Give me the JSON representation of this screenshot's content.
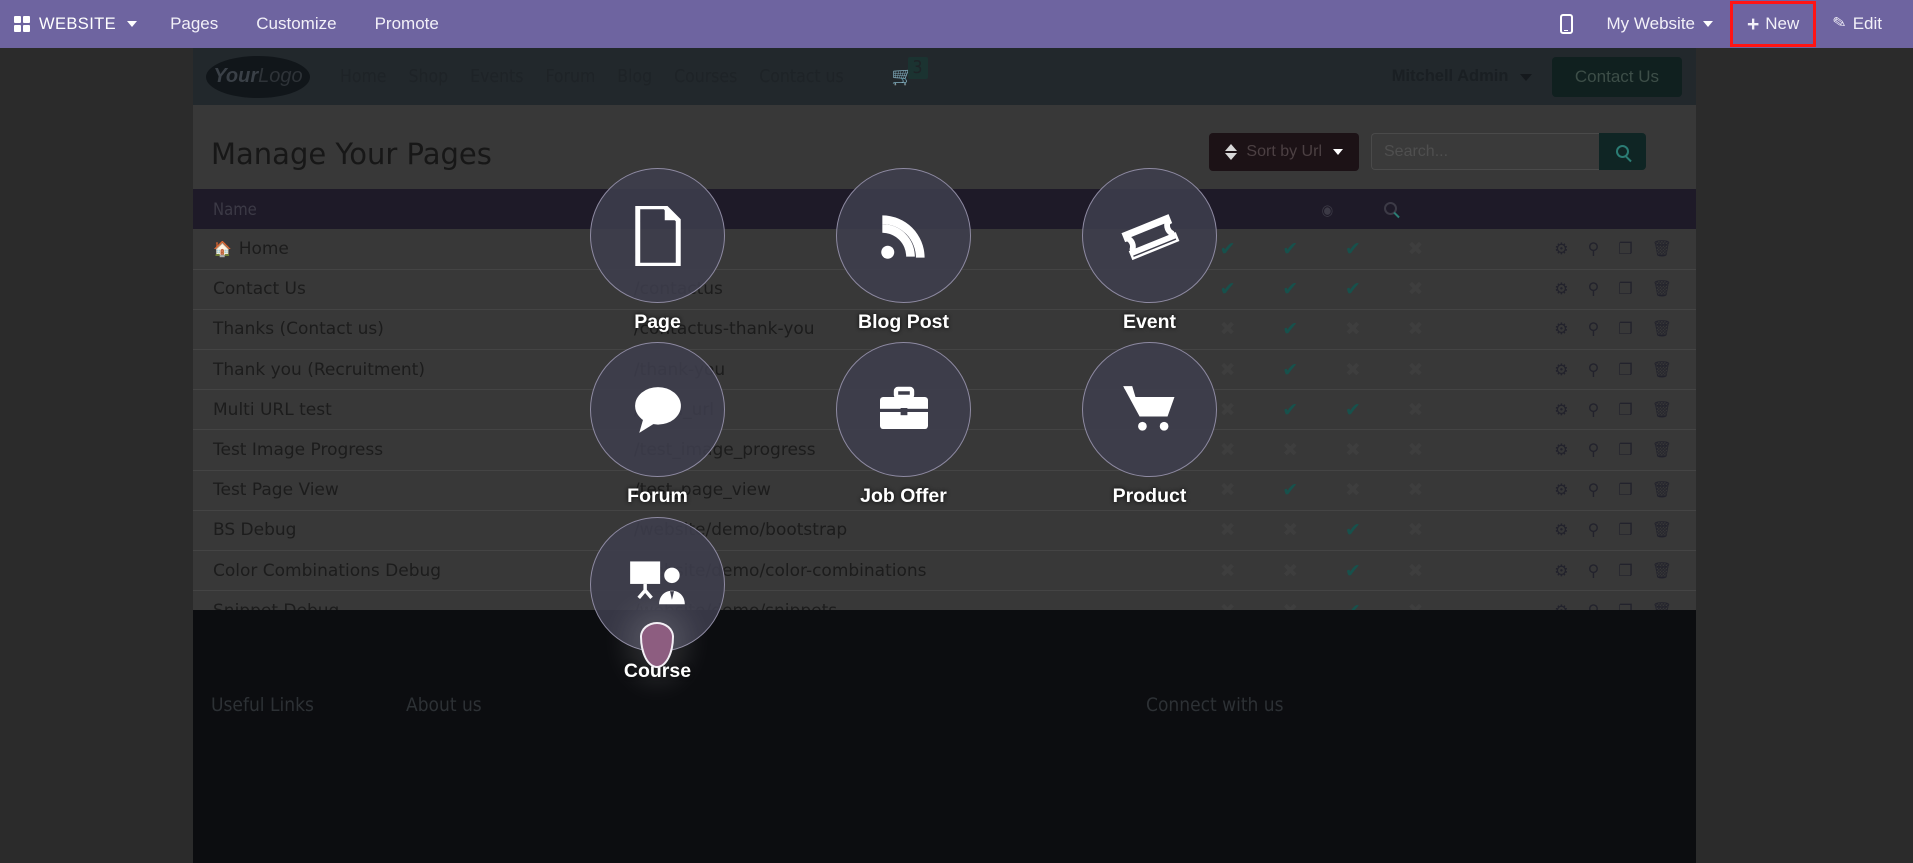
{
  "topbar": {
    "brand": "WEBSITE",
    "grid_icon": "apps-grid-icon",
    "menu": [
      "Pages",
      "Customize",
      "Promote"
    ],
    "mobile_preview_icon": "mobile-phone-icon",
    "website_selector": "My Website",
    "new_button": "New",
    "new_plus_icon": "plus-icon",
    "edit_button": "Edit",
    "edit_icon": "pencil-icon",
    "highlight_color": "#ff1414",
    "background": "#6e64a0"
  },
  "site_header": {
    "logo_your": "Your",
    "logo_logo": "Logo",
    "nav": [
      "Home",
      "Shop",
      "Events",
      "Forum",
      "Blog",
      "Courses",
      "Contact us"
    ],
    "cart_icon": "shopping-cart-icon",
    "cart_count": "3",
    "user_name": "Mitchell Admin",
    "cta_button": "Contact Us",
    "background": "#22282c"
  },
  "page": {
    "title": "Manage Your Pages",
    "sort_button": "Sort by Url",
    "sort_icon": "sort-updown-icon",
    "search_placeholder": "Search...",
    "search_value": "",
    "search_icon": "search-icon"
  },
  "table": {
    "columns": [
      {
        "label": "Name",
        "type": "text"
      },
      {
        "label": "",
        "type": "text"
      },
      {
        "label": "",
        "type": "flag",
        "icon": "globe-icon"
      },
      {
        "label": "",
        "type": "flag",
        "icon": "user-icon"
      },
      {
        "label": "",
        "type": "flag",
        "icon": "clock-icon"
      },
      {
        "label": "",
        "type": "flag",
        "icon": "search-icon"
      },
      {
        "label": "",
        "type": "actions"
      }
    ],
    "header_icons": [
      "globe-icon",
      "search-icon"
    ],
    "row_actions": [
      "gear-icon",
      "search-icon",
      "duplicate-icon",
      "trash-icon"
    ],
    "rows": [
      {
        "name": "Home",
        "home_icon": "home-icon",
        "url": "/",
        "flags": [
          "check",
          "check",
          "check",
          "cross"
        ]
      },
      {
        "name": "Contact Us",
        "home_icon": "",
        "url": "/contactus",
        "flags": [
          "check",
          "check",
          "check",
          "cross"
        ]
      },
      {
        "name": "Thanks (Contact us)",
        "home_icon": "",
        "url": "/contactus-thank-you",
        "flags": [
          "cross",
          "check",
          "cross",
          "cross"
        ]
      },
      {
        "name": "Thank you (Recruitment)",
        "home_icon": "",
        "url": "/thank-you",
        "flags": [
          "cross",
          "check",
          "cross",
          "cross"
        ]
      },
      {
        "name": "Multi URL test",
        "home_icon": "",
        "url": "/multi_url",
        "flags": [
          "cross",
          "check",
          "check",
          "cross"
        ]
      },
      {
        "name": "Test Image Progress",
        "home_icon": "",
        "url": "/test_image_progress",
        "flags": [
          "cross",
          "cross",
          "cross",
          "cross"
        ]
      },
      {
        "name": "Test Page View",
        "home_icon": "",
        "url": "/test_page_view",
        "flags": [
          "cross",
          "check",
          "cross",
          "cross"
        ]
      },
      {
        "name": "BS Debug",
        "home_icon": "",
        "url": "/website/demo/bootstrap",
        "flags": [
          "cross",
          "cross",
          "check",
          "cross"
        ]
      },
      {
        "name": "Color Combinations Debug",
        "home_icon": "",
        "url": "/website/demo/color-combinations",
        "flags": [
          "cross",
          "cross",
          "check",
          "cross"
        ]
      },
      {
        "name": "Snippet Debug",
        "home_icon": "",
        "url": "/website/demo/snippets",
        "flags": [
          "cross",
          "cross",
          "check",
          "cross"
        ]
      }
    ]
  },
  "new_page_overlay": {
    "items": [
      {
        "label": "Page",
        "icon": "file-document-icon"
      },
      {
        "label": "Blog Post",
        "icon": "rss-feed-icon"
      },
      {
        "label": "Event",
        "icon": "ticket-icon"
      },
      {
        "label": "Forum",
        "icon": "chat-bubble-icon"
      },
      {
        "label": "Job Offer",
        "icon": "briefcase-icon"
      },
      {
        "label": "Product",
        "icon": "shopping-cart-icon"
      },
      {
        "label": "Course",
        "icon": "presentation-teacher-icon"
      }
    ],
    "cursor_icon": "droplet-cursor-icon",
    "circle_background": "#3e3e4c",
    "circle_border": "#8e8aa2"
  },
  "footer": {
    "columns": [
      "Useful Links",
      "About us",
      "Connect with us"
    ]
  }
}
